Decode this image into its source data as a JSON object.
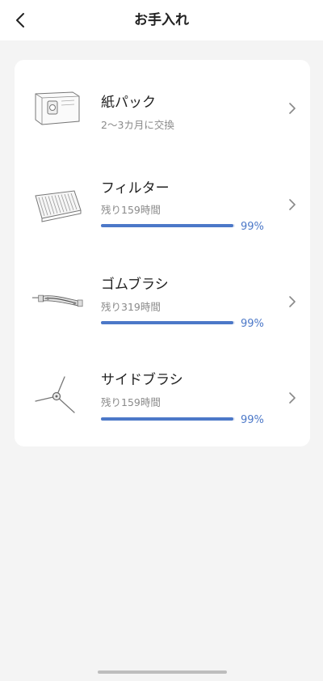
{
  "header": {
    "title": "お手入れ",
    "back_icon": "chevron-left-icon"
  },
  "accent_color": "#4c78c8",
  "items": [
    {
      "name": "紙パック",
      "subtitle": "2〜3カ月に交換",
      "icon": "dust-bag-icon"
    },
    {
      "name": "フィルター",
      "subtitle": "残り159時間",
      "progress": 0.99,
      "percent_label": "99%",
      "icon": "filter-icon"
    },
    {
      "name": "ゴムブラシ",
      "subtitle": "残り319時間",
      "progress": 0.99,
      "percent_label": "99%",
      "icon": "rubber-brush-icon"
    },
    {
      "name": "サイドブラシ",
      "subtitle": "残り159時間",
      "progress": 0.99,
      "percent_label": "99%",
      "icon": "side-brush-icon"
    }
  ]
}
